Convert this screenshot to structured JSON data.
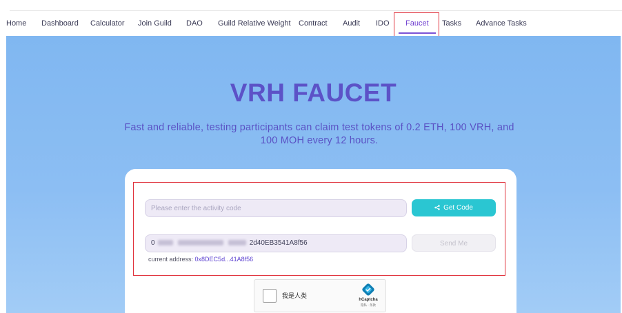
{
  "nav": {
    "items": [
      {
        "label": "Home",
        "active": false
      },
      {
        "label": "Dashboard",
        "active": false
      },
      {
        "label": "Calculator",
        "active": false
      },
      {
        "label": "Join Guild",
        "active": false
      },
      {
        "label": "DAO",
        "active": false
      },
      {
        "label": "Guild Relative Weight",
        "active": false
      },
      {
        "label": "Contract",
        "active": false
      },
      {
        "label": "Audit",
        "active": false
      },
      {
        "label": "IDO",
        "active": false
      },
      {
        "label": "Faucet",
        "active": true
      },
      {
        "label": "Tasks",
        "active": false
      },
      {
        "label": "Advance Tasks",
        "active": false
      }
    ]
  },
  "hero": {
    "title": "VRH FAUCET",
    "subtitle": "Fast and reliable, testing participants can claim test tokens of 0.2 ETH, 100 VRH, and 100 MOH every 12 hours."
  },
  "form": {
    "code_placeholder": "Please enter the activity code",
    "get_code_label": "Get Code",
    "address_prefix": "0",
    "address_suffix": "2d40EB3541A8f56",
    "send_label": "Send Me",
    "current_address_label": "current address:",
    "current_address_value": "0x8DEC5d...41A8f56"
  },
  "captcha": {
    "label": "我是人类",
    "brand": "hCaptcha",
    "links": "隐私 - 条款"
  },
  "colors": {
    "accent": "#6f3fd0",
    "title": "#5c52c7",
    "button": "#2ac6d2",
    "highlight_border": "#e0323c",
    "hero_bg": "#80b7f1"
  }
}
